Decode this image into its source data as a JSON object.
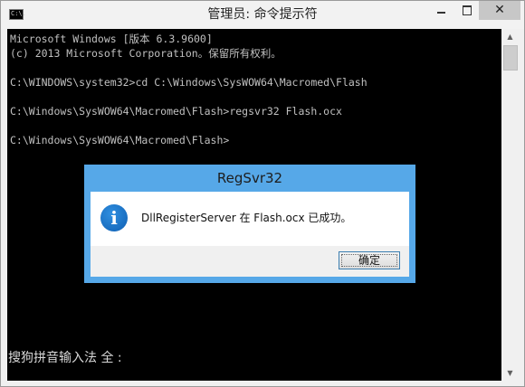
{
  "window": {
    "title": "管理员: 命令提示符",
    "icon_label": "C:\\.",
    "minimize_glyph": "",
    "maximize_glyph": "",
    "close_glyph": "✕"
  },
  "console": {
    "lines": [
      "Microsoft Windows [版本 6.3.9600]",
      "(c) 2013 Microsoft Corporation。保留所有权利。",
      "",
      "C:\\WINDOWS\\system32>cd C:\\Windows\\SysWOW64\\Macromed\\Flash",
      "",
      "C:\\Windows\\SysWOW64\\Macromed\\Flash>regsvr32 Flash.ocx",
      "",
      "C:\\Windows\\SysWOW64\\Macromed\\Flash>"
    ],
    "ime_status": "搜狗拼音输入法 全 :"
  },
  "scrollbar": {
    "up_arrow": "▲",
    "down_arrow": "▼"
  },
  "dialog": {
    "title": "RegSvr32",
    "icon": "info-icon",
    "icon_glyph": "i",
    "message": "DllRegisterServer 在 Flash.ocx 已成功。",
    "ok_label": "确定"
  },
  "colors": {
    "console_bg": "#000000",
    "console_fg": "#c0c0c0",
    "dialog_frame": "#56a8e8",
    "close_button_bg": "#c7c7c7"
  }
}
